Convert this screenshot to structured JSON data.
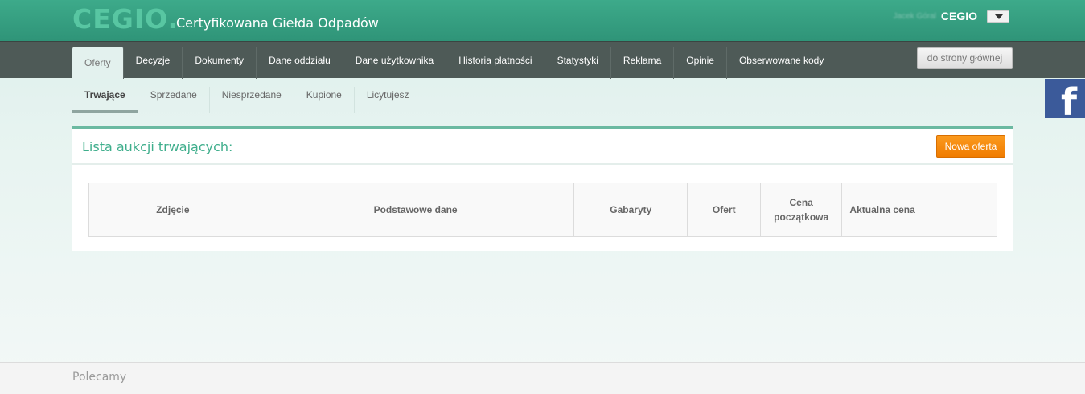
{
  "header": {
    "logo": "CEGIO.",
    "title": "Certyfikowana Giełda Odpadów",
    "user_name": "Jacek Góral",
    "user_company": "CEGIO"
  },
  "mainnav": {
    "items": [
      "Oferty",
      "Decyzje",
      "Dokumenty",
      "Dane oddziału",
      "Dane użytkownika",
      "Historia płatności",
      "Statystyki",
      "Reklama",
      "Opinie",
      "Obserwowane kody"
    ],
    "active": "Oferty",
    "home_button": "do strony głównej"
  },
  "subnav": {
    "items": [
      "Trwające",
      "Sprzedane",
      "Niesprzedane",
      "Kupione",
      "Licytujesz"
    ],
    "active": "Trwające"
  },
  "panel": {
    "title": "Lista aukcji trwających:",
    "new_offer_button": "Nowa oferta",
    "columns": [
      "Zdjęcie",
      "Podstawowe dane",
      "Gabaryty",
      "Ofert",
      "Cena początkowa",
      "Aktualna cena",
      ""
    ]
  },
  "footer": {
    "label": "Polecamy"
  },
  "icons": {
    "facebook": "facebook-icon",
    "user_dropdown": "chevron-down-icon"
  },
  "colors": {
    "brand": "#3daa8a",
    "nav": "#4e5a57",
    "accent_button": "#f58a0b",
    "facebook": "#3b5a9a"
  }
}
